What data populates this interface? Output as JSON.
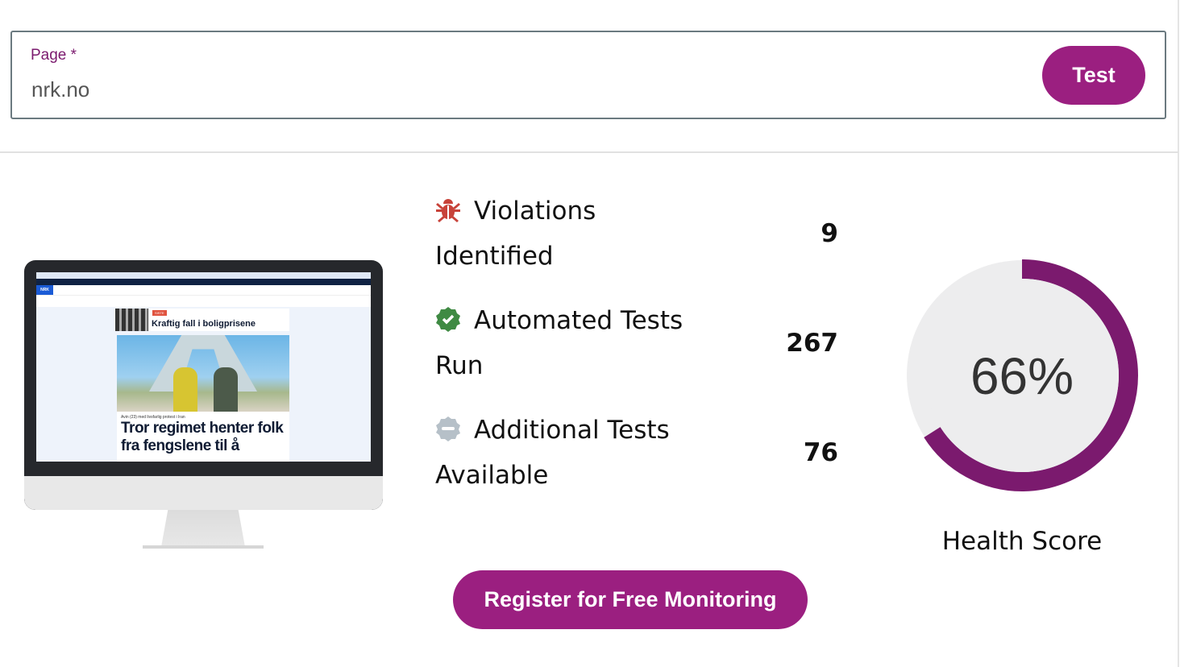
{
  "form": {
    "label": "Page",
    "required_mark": "*",
    "value": "nrk.no",
    "test_label": "Test"
  },
  "preview": {
    "nav_logo": "NRK",
    "badge": "SISTE",
    "breaking_headline": "Kraftig fall i boligprisene",
    "kicker": "Avin (23) med livsfarlig protest i Iran",
    "main_headline": "Tror regimet henter folk fra fengslene til å"
  },
  "stats": [
    {
      "icon": "bug-icon",
      "label_line1": "Violations",
      "label_line2": "Identified",
      "value": "9",
      "color": "#c8433a"
    },
    {
      "icon": "check-badge-icon",
      "label_line1": "Automated Tests",
      "label_line2": "Run",
      "value": "267",
      "color": "#3f8a43"
    },
    {
      "icon": "minus-badge-icon",
      "label_line1": "Additional Tests",
      "label_line2": "Available",
      "value": "76",
      "color": "#b6c0c8"
    }
  ],
  "health": {
    "score_text": "66%",
    "score": 66,
    "label": "Health Score",
    "color": "#7b1a6e"
  },
  "register_label": "Register for Free Monitoring",
  "accent": "#9b1f80"
}
